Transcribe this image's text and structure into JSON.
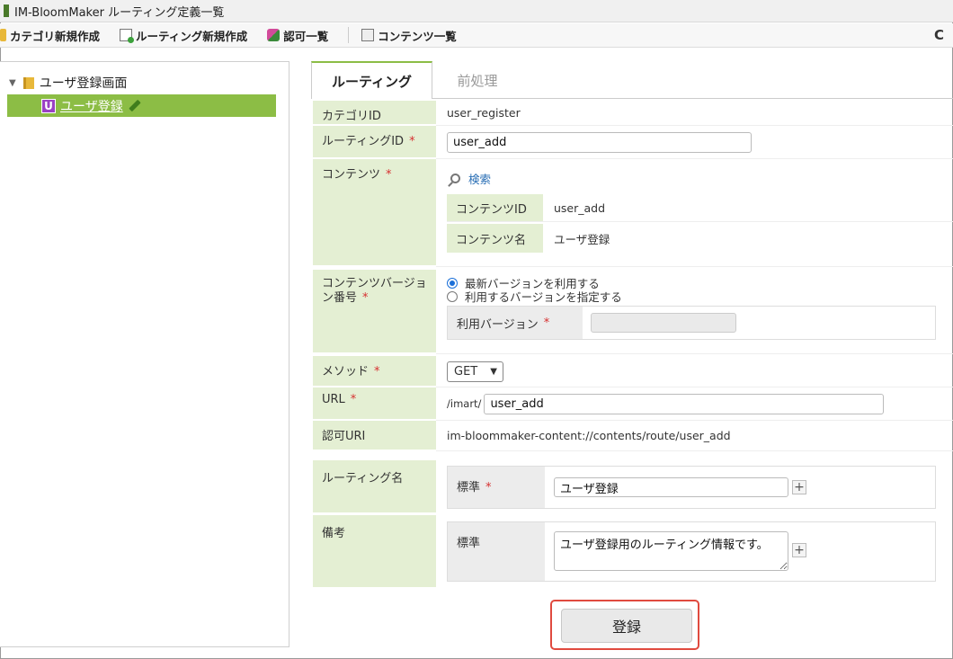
{
  "window": {
    "title": "IM-BloomMaker ルーティング定義一覧"
  },
  "toolbar": {
    "new_category": "カテゴリ新規作成",
    "new_routing": "ルーティング新規作成",
    "auth_list": "認可一覧",
    "content_list": "コンテンツ一覧",
    "refresh_icon": "C"
  },
  "tree": {
    "root_label": "ユーザ登録画面",
    "selected_badge": "U",
    "selected_label": "ユーザ登録"
  },
  "tabs": {
    "active": "ルーティング",
    "inactive": "前処理"
  },
  "form": {
    "category_id_label": "カテゴリID",
    "category_id_value": "user_register",
    "routing_id_label": "ルーティングID",
    "routing_id_value": "user_add",
    "content_label": "コンテンツ",
    "search_link": "検索",
    "content_id_label": "コンテンツID",
    "content_id_value": "user_add",
    "content_name_label": "コンテンツ名",
    "content_name_value": "ユーザ登録",
    "version_label": "コンテンツバージョン番号",
    "version_option_latest": "最新バージョンを利用する",
    "version_option_specify": "利用するバージョンを指定する",
    "use_version_label": "利用バージョン",
    "method_label": "メソッド",
    "method_value": "GET",
    "url_label": "URL",
    "url_prefix": "/imart/",
    "url_value": "user_add",
    "auth_uri_label": "認可URI",
    "auth_uri_value": "im-bloommaker-content://contents/route/user_add",
    "routing_name_label": "ルーティング名",
    "standard_label": "標準",
    "routing_name_value": "ユーザ登録",
    "note_label": "備考",
    "note_standard_label": "標準",
    "note_value": "ユーザ登録用のルーティング情報です。",
    "required_mark": "*",
    "plus": "+"
  },
  "buttons": {
    "register": "登録"
  }
}
